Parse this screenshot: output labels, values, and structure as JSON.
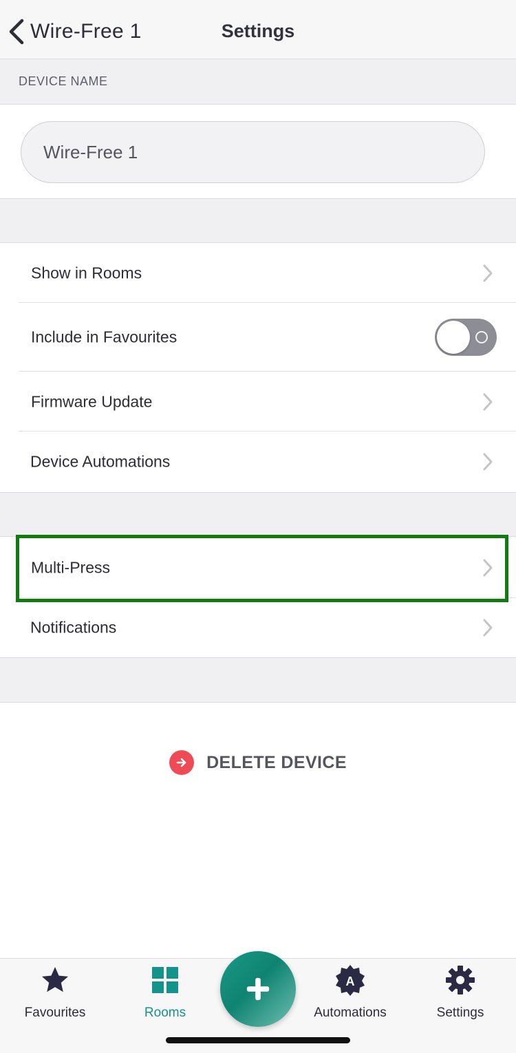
{
  "header": {
    "back_label": "Wire-Free 1",
    "title": "Settings"
  },
  "device_name_section": {
    "label": "DEVICE NAME",
    "value": "Wire-Free 1"
  },
  "rows_group1": [
    {
      "label": "Show in Rooms"
    },
    {
      "label": "Include in Favourites"
    },
    {
      "label": "Firmware Update"
    },
    {
      "label": "Device Automations"
    }
  ],
  "favourites_toggle": {
    "state": "off"
  },
  "rows_group2": [
    {
      "label": "Multi-Press"
    },
    {
      "label": "Notifications"
    }
  ],
  "delete": {
    "label": "DELETE DEVICE"
  },
  "tabbar": {
    "items": [
      {
        "label": "Favourites",
        "icon": "star-icon"
      },
      {
        "label": "Rooms",
        "icon": "grid-icon"
      },
      {
        "label": "Automations",
        "icon": "automations-icon"
      },
      {
        "label": "Settings",
        "icon": "gear-icon"
      }
    ],
    "active": "Rooms",
    "fab_icon": "plus-icon"
  },
  "colors": {
    "accent": "#13938a",
    "delete": "#ef4b57",
    "highlight": "#117a11",
    "text": "#2d2d3a"
  }
}
